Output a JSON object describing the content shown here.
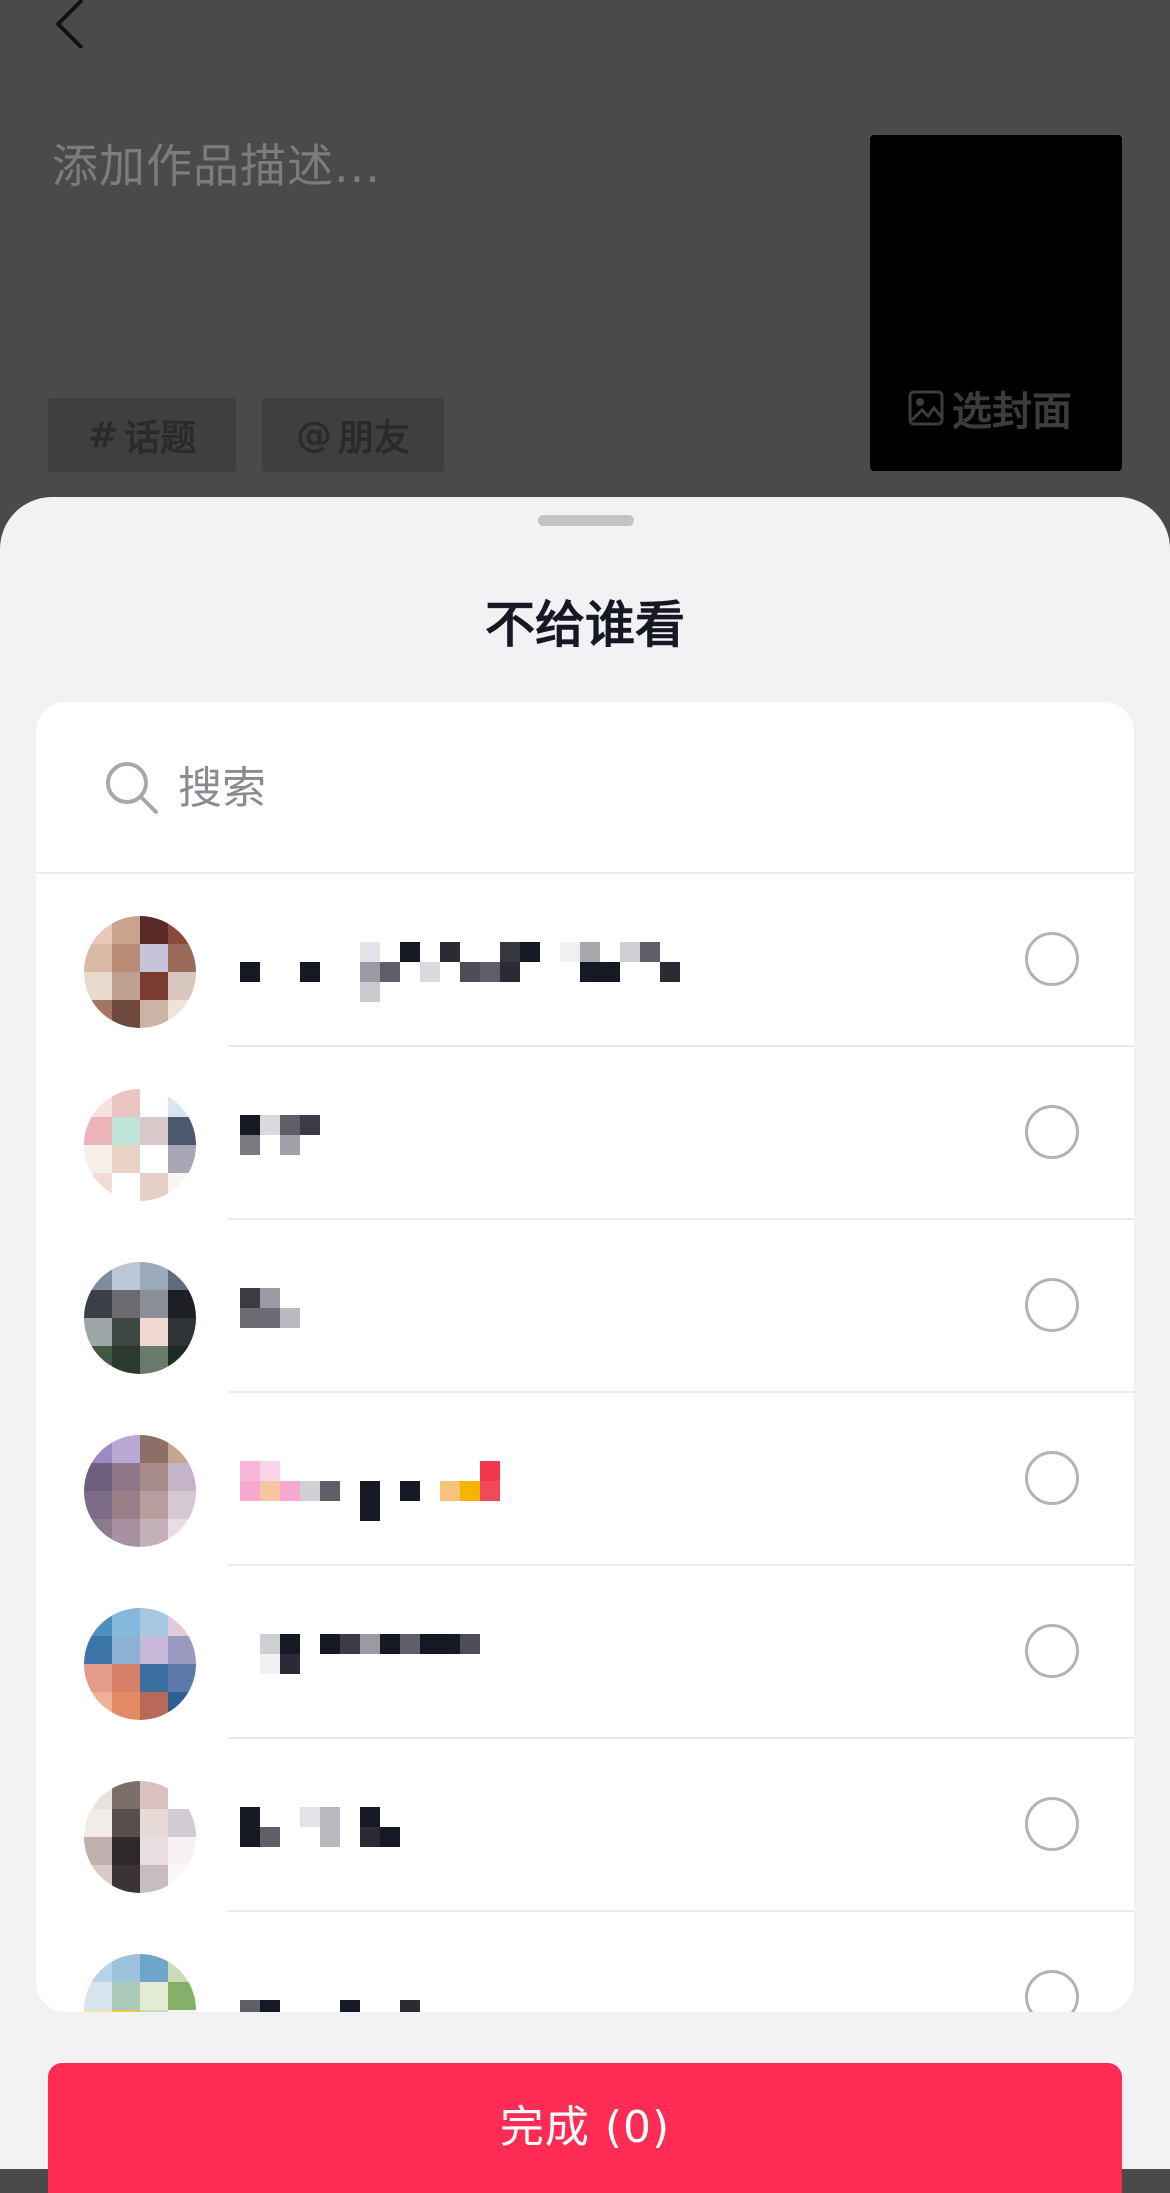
{
  "background": {
    "description_placeholder": "添加作品描述...",
    "chips": [
      {
        "symbol": "#",
        "label": "话题"
      },
      {
        "symbol": "@",
        "label": "朋友"
      }
    ],
    "cover_label": "选封面"
  },
  "sheet": {
    "title": "不给谁看",
    "search": {
      "placeholder": "搜索",
      "value": ""
    },
    "friends": [
      {
        "avatar": "avatar-1",
        "selected": false
      },
      {
        "avatar": "avatar-2",
        "selected": false
      },
      {
        "avatar": "avatar-3",
        "selected": false
      },
      {
        "avatar": "avatar-4",
        "selected": false
      },
      {
        "avatar": "avatar-5",
        "selected": false
      },
      {
        "avatar": "avatar-6",
        "selected": false
      },
      {
        "avatar": "avatar-7",
        "selected": false
      }
    ],
    "done_button": "完成 (0)"
  },
  "colors": {
    "accent": "#fe2c55",
    "sheet_bg": "#f2f2f5",
    "overlay_bg": "#4a4a4a"
  },
  "icons": [
    "back-arrow-icon",
    "image-icon",
    "search-icon"
  ]
}
